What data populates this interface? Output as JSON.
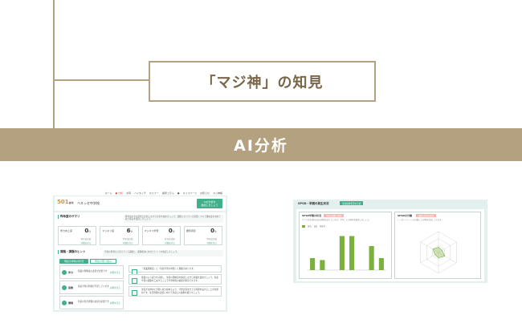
{
  "header": {
    "knowledge_title": "「マジ神」の知見",
    "banner_title": "AI分析"
  },
  "left_screen": {
    "nav": [
      {
        "label": "ホーム",
        "active": false
      },
      {
        "label": "● 分析",
        "active": true
      },
      {
        "label": "共有",
        "active": false
      },
      {
        "label": "ハイタッチ",
        "active": false
      },
      {
        "label": "セミナー",
        "active": false
      },
      {
        "label": "講習コラム",
        "active": false
      },
      {
        "label": "●",
        "active": false
      },
      {
        "label": "マイスペース",
        "active": false
      },
      {
        "label": "お知らせ",
        "active": false
      },
      {
        "label": "マジ神帳",
        "active": false
      }
    ],
    "school": {
      "number": "501",
      "suffix": "番地",
      "name": "ベネッセ中学校"
    },
    "ai_button": "AIの分析を\n確認しましょう",
    "summary": {
      "title": "昨年度のサマリ",
      "note": "昨年度の主な結果と比較しながら分析を進めましょう。課題となっている項目について優先度を決めて取り組みを検討しましょう。",
      "stats": [
        {
          "label": "学力向上度",
          "value": "0",
          "unit": "件",
          "sub": "昨年度比較",
          "link": "詳細を見る"
        },
        {
          "label": "マジネス度",
          "value": "6",
          "unit": "件",
          "sub": "昨年度比較",
          "link": "詳細を見る"
        },
        {
          "label": "マジネス学習",
          "value": "0",
          "unit": "件",
          "sub": "昨年度比較",
          "link": "詳細を見る"
        },
        {
          "label": "課題項目",
          "value": "0",
          "unit": "件",
          "sub": "昨年度比較",
          "link": "詳細を見る"
        }
      ]
    },
    "issues": {
      "title": "課題・課題のヒント",
      "note": "学校の現状から見えてくる課題と、課題解決に向けたヒントを確認しましょう。",
      "tabs": [
        {
          "label": "現在の学校の状況",
          "active": true
        },
        {
          "label": "現在の取り組み",
          "active": false
        }
      ],
      "rows": [
        {
          "label": "学力",
          "text": "授業の理解度の改善が必要です",
          "link": "詳細を見る"
        },
        {
          "label": "意欲",
          "text": "家庭学習の時間が不足しています",
          "link": "詳細を見る"
        },
        {
          "label": "環境",
          "text": "生徒の生活習慣の改善が必要です",
          "link": "詳細を見る"
        }
      ],
      "advice": [
        {
          "text": "「授業理解度」と「家庭学習の時間」に関連があります。"
        },
        {
          "text": "授業のふり返りを実施し、生徒の理解度を確認しながら授業を進めましょう。家庭学習の課題を工夫することで学習時間の確保が期待できます。"
        },
        {
          "text": "生徒が主体的に学習に取り組めるよう、学習計画を立てる時間を設けることが効果的です。生活習慣の改善に向けて家庭との連携を図りましょう。"
        }
      ]
    }
  },
  "right_screen": {
    "title": "SPSD・早期の発生状況",
    "badge": "生徒指導状況の分析",
    "cards": [
      {
        "title": "SPSD早期の状況",
        "badge": "学校の課題と関連",
        "desc": "グラフは各項目の該当者数を表しています。学年ごとの傾向を確認しましょう。",
        "legend": [
          "該当",
          "非該当"
        ]
      },
      {
        "title": "SPSDの分類",
        "badge": "課題の傾向を確認",
        "desc": "レーダーチャートは分類ごとの傾向を表しています。"
      }
    ]
  },
  "chart_data": [
    {
      "type": "bar",
      "title": "SPSD早期の状況",
      "categories": [
        "c1",
        "c2",
        "c3",
        "c4",
        "c5",
        "c6",
        "c7",
        "c8"
      ],
      "values": [
        30,
        25,
        0,
        85,
        85,
        0,
        60,
        30
      ],
      "ylim": [
        0,
        100
      ]
    },
    {
      "type": "radar",
      "title": "SPSDの分類",
      "categories": [
        "a1",
        "a2",
        "a3",
        "a4",
        "a5",
        "a6"
      ],
      "values": [
        0.25,
        0.2,
        0.35,
        0.25,
        0.2,
        0.3
      ],
      "ylim": [
        0,
        1
      ]
    }
  ]
}
